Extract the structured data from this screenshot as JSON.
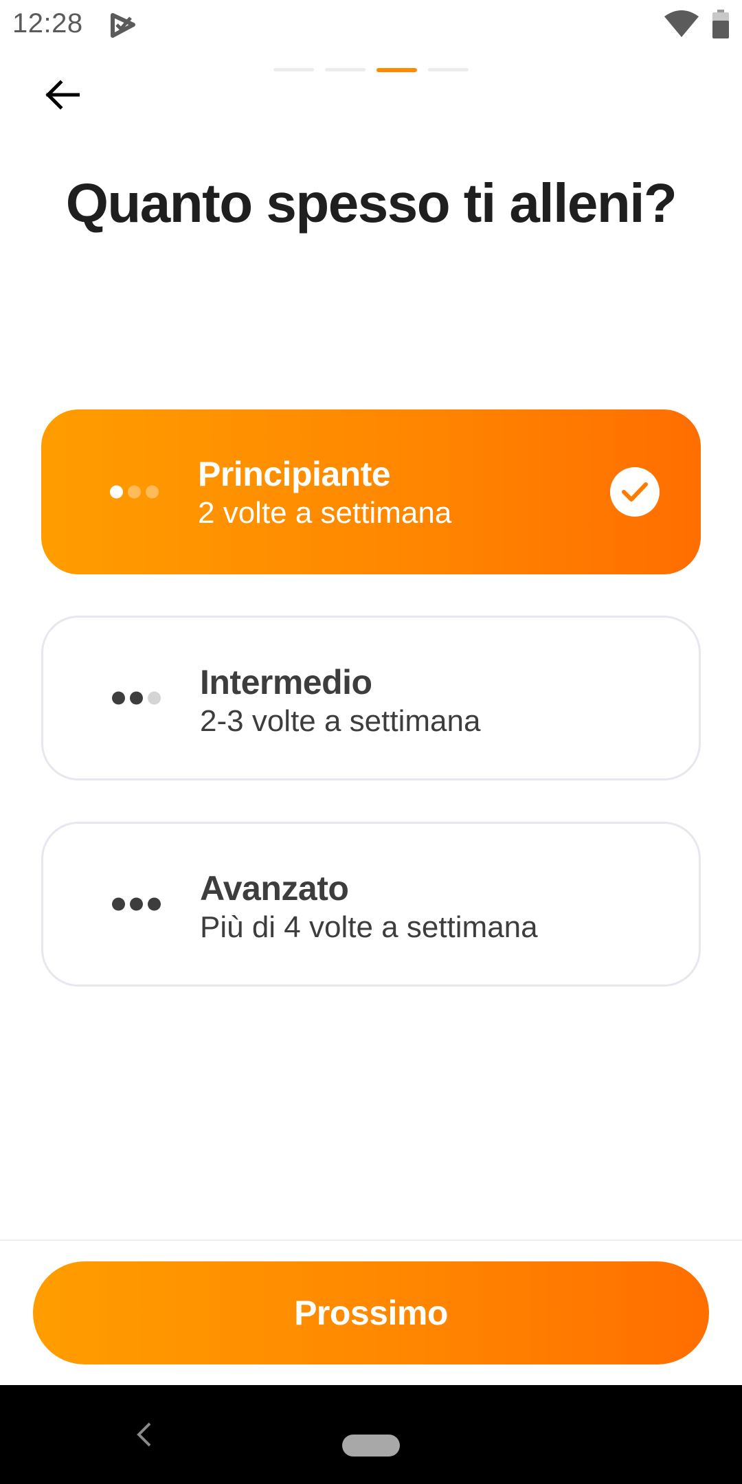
{
  "status_bar": {
    "time": "12:28"
  },
  "header": {
    "progress": {
      "total_steps": 4,
      "current_step": 3
    }
  },
  "question": {
    "title": "Quanto spesso ti alleni?"
  },
  "options": [
    {
      "title": "Principiante",
      "subtitle": "2 volte a settimana",
      "level": 1,
      "selected": true
    },
    {
      "title": "Intermedio",
      "subtitle": "2-3 volte a settimana",
      "level": 2,
      "selected": false
    },
    {
      "title": "Avanzato",
      "subtitle": "Più di 4 volte a settimana",
      "level": 3,
      "selected": false
    }
  ],
  "footer": {
    "next_label": "Prossimo"
  },
  "colors": {
    "accent_start": "#ff9d00",
    "accent_end": "#ff6e00",
    "title_text": "#1f1f1f",
    "option_text": "#3d3d3d",
    "card_border": "#e8e7ef"
  },
  "icons": {
    "back": "arrow-left-icon",
    "check": "checkmark-icon",
    "status_app": "play-check-icon",
    "wifi": "wifi-icon",
    "battery": "battery-icon"
  }
}
